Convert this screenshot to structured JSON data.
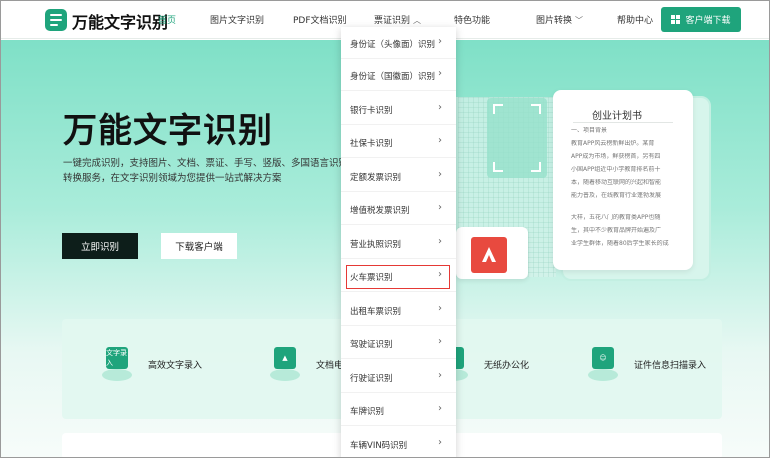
{
  "app": {
    "name": "万能文字识别"
  },
  "nav": [
    {
      "label": "首页",
      "active": true
    },
    {
      "label": "图片文字识别"
    },
    {
      "label": "PDF文档识别"
    },
    {
      "label": "票证识别",
      "expanded": true
    },
    {
      "label": "特色功能"
    },
    {
      "label": "图片转换"
    },
    {
      "label": "帮助中心"
    }
  ],
  "download_btn": {
    "label": "客户端下载"
  },
  "hero": {
    "title": "万能文字识别",
    "desc_line1": "一键完成识别，支持图片、文档、票证、手写、竖版、多国语言识别",
    "desc_line2": "转换服务，在文字识别领域为您提供一站式解决方案",
    "primary_btn": "立即识别",
    "secondary_btn": "下载客户端"
  },
  "illustration": {
    "doc_title": "创业计划书",
    "doc_lines": [
      "一、项目背景",
      "教育APP风云榜新鲜出炉。某育",
      "APP成为市场，鲜获榜首，另有四",
      "小国APP组近中小学教育排名前十",
      "本，随着移动互联网的兴起和智能",
      "能力普及，在线教育行业蓬勃发展",
      "大样，五花八门的教育类APP也随",
      "生，其中不少教育品牌开始遍及广",
      "业学生群体，随着80后学生家长的成"
    ]
  },
  "features": [
    {
      "label": "高效文字录入",
      "icon_text": "文字录入"
    },
    {
      "label": "文档电"
    },
    {
      "label": "无纸办公化"
    },
    {
      "label": "证件信息扫描录入"
    }
  ],
  "dropdown": {
    "items": [
      {
        "label": "身份证（头像面）识别"
      },
      {
        "label": "身份证（国徽面）识别"
      },
      {
        "label": "银行卡识别"
      },
      {
        "label": "社保卡识别"
      },
      {
        "label": "定额发票识别"
      },
      {
        "label": "增值税发票识别"
      },
      {
        "label": "营业执照识别"
      },
      {
        "label": "火车票识别",
        "highlighted": true
      },
      {
        "label": "出租车票识别"
      },
      {
        "label": "驾驶证识别"
      },
      {
        "label": "行驶证识别"
      },
      {
        "label": "车牌识别"
      },
      {
        "label": "车辆VIN码识别"
      }
    ]
  },
  "colors": {
    "brand": "#1fa47c",
    "highlight": "#e53935",
    "pdf": "#e84a3f"
  }
}
